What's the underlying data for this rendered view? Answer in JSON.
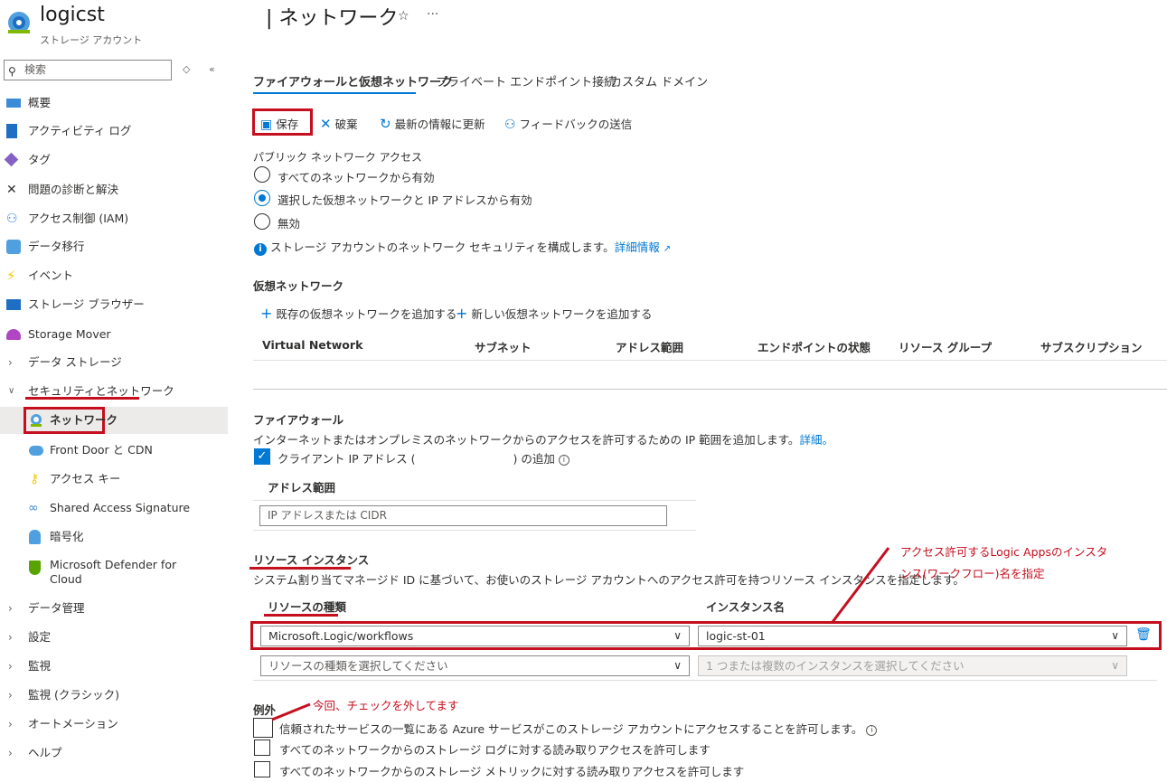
{
  "resource": {
    "name": "logicst",
    "type": "ストレージ アカウント"
  },
  "sidebar": {
    "search_placeholder": "検索",
    "items": [
      {
        "label": "概要",
        "icon": "overview-icon"
      },
      {
        "label": "アクティビティ ログ",
        "icon": "activity-log-icon"
      },
      {
        "label": "タグ",
        "icon": "tag-icon"
      },
      {
        "label": "問題の診断と解決",
        "icon": "diagnose-icon"
      },
      {
        "label": "アクセス制御 (IAM)",
        "icon": "iam-icon"
      },
      {
        "label": "データ移行",
        "icon": "data-migration-icon"
      },
      {
        "label": "イベント",
        "icon": "event-icon"
      },
      {
        "label": "ストレージ ブラウザー",
        "icon": "storage-browser-icon"
      },
      {
        "label": "Storage Mover",
        "icon": "storage-mover-icon"
      },
      {
        "label": "データ ストレージ",
        "icon": "chevron-right-icon"
      },
      {
        "label": "セキュリティとネットワーク",
        "icon": "chevron-down-icon"
      },
      {
        "label": "ネットワーク",
        "icon": "network-icon"
      },
      {
        "label": "Front Door と CDN",
        "icon": "cloud-icon"
      },
      {
        "label": "アクセス キー",
        "icon": "key-icon"
      },
      {
        "label": "Shared Access Signature",
        "icon": "link-icon"
      },
      {
        "label": "暗号化",
        "icon": "lock-icon"
      },
      {
        "label": "Microsoft Defender for Cloud",
        "icon": "defender-icon"
      },
      {
        "label": "データ管理",
        "icon": "chevron-right-icon"
      },
      {
        "label": "設定",
        "icon": "chevron-right-icon"
      },
      {
        "label": "監視",
        "icon": "chevron-right-icon"
      },
      {
        "label": "監視 (クラシック)",
        "icon": "chevron-right-icon"
      },
      {
        "label": "オートメーション",
        "icon": "chevron-right-icon"
      },
      {
        "label": "ヘルプ",
        "icon": "chevron-right-icon"
      }
    ]
  },
  "page": {
    "title": "| ネットワーク"
  },
  "tabs": [
    "ファイアウォールと仮想ネットワーク",
    "プライベート エンドポイント接続",
    "カスタム ドメイン"
  ],
  "toolbar": {
    "save": "保存",
    "discard": "破棄",
    "refresh": "最新の情報に更新",
    "feedback": "フィードバックの送信"
  },
  "public_access": {
    "label": "パブリック ネットワーク アクセス",
    "options": [
      "すべてのネットワークから有効",
      "選択した仮想ネットワークと IP アドレスから有効",
      "無効"
    ],
    "selected_index": 1,
    "info": "ストレージ アカウントのネットワーク セキュリティを構成します。",
    "info_link": "詳細情報"
  },
  "vnet": {
    "title": "仮想ネットワーク",
    "add_existing": "既存の仮想ネットワークを追加する",
    "add_new": "新しい仮想ネットワークを追加する",
    "columns": [
      "Virtual Network",
      "サブネット",
      "アドレス範囲",
      "エンドポイントの状態",
      "リソース グループ",
      "サブスクリプション"
    ]
  },
  "firewall": {
    "title": "ファイアウォール",
    "desc": "インターネットまたはオンプレミスのネットワークからのアクセスを許可するための IP 範囲を追加します。",
    "desc_link": "詳細。",
    "client_ip_prefix": "クライアント IP アドレス (",
    "client_ip_suffix": ") の追加",
    "client_ip_checked": true,
    "address_range_header": "アドレス範囲",
    "address_placeholder": "IP アドレスまたは CIDR"
  },
  "resource_instances": {
    "title": "リソース インスタンス",
    "desc": "システム割り当てマネージド ID に基づいて、お使いのストレージ アカウントへのアクセス許可を持つリソース インスタンスを指定します。",
    "type_header": "リソースの種類",
    "instance_header": "インスタンス名",
    "row_type": "Microsoft.Logic/workflows",
    "row_instance": "logic-st-01",
    "type_placeholder": "リソースの種類を選択してください",
    "instance_placeholder": "1 つまたは複数のインスタンスを選択してください"
  },
  "exceptions": {
    "title": "例外",
    "items": [
      {
        "label": "信頼されたサービスの一覧にある Azure サービスがこのストレージ アカウントにアクセスすることを許可します。",
        "checked": false
      },
      {
        "label": "すべてのネットワークからのストレージ ログに対する読み取りアクセスを許可します",
        "checked": false
      },
      {
        "label": "すべてのネットワークからのストレージ メトリックに対する読み取りアクセスを許可します",
        "checked": false
      }
    ]
  },
  "annotations": {
    "instance_note_1": "アクセス許可するLogic Appsのインスタ",
    "instance_note_2": "ンス(ワークフロー)名を指定",
    "exception_note": "今回、チェックを外してます"
  },
  "colors": {
    "accent": "#0078d4",
    "annotation": "#c50f1f"
  }
}
